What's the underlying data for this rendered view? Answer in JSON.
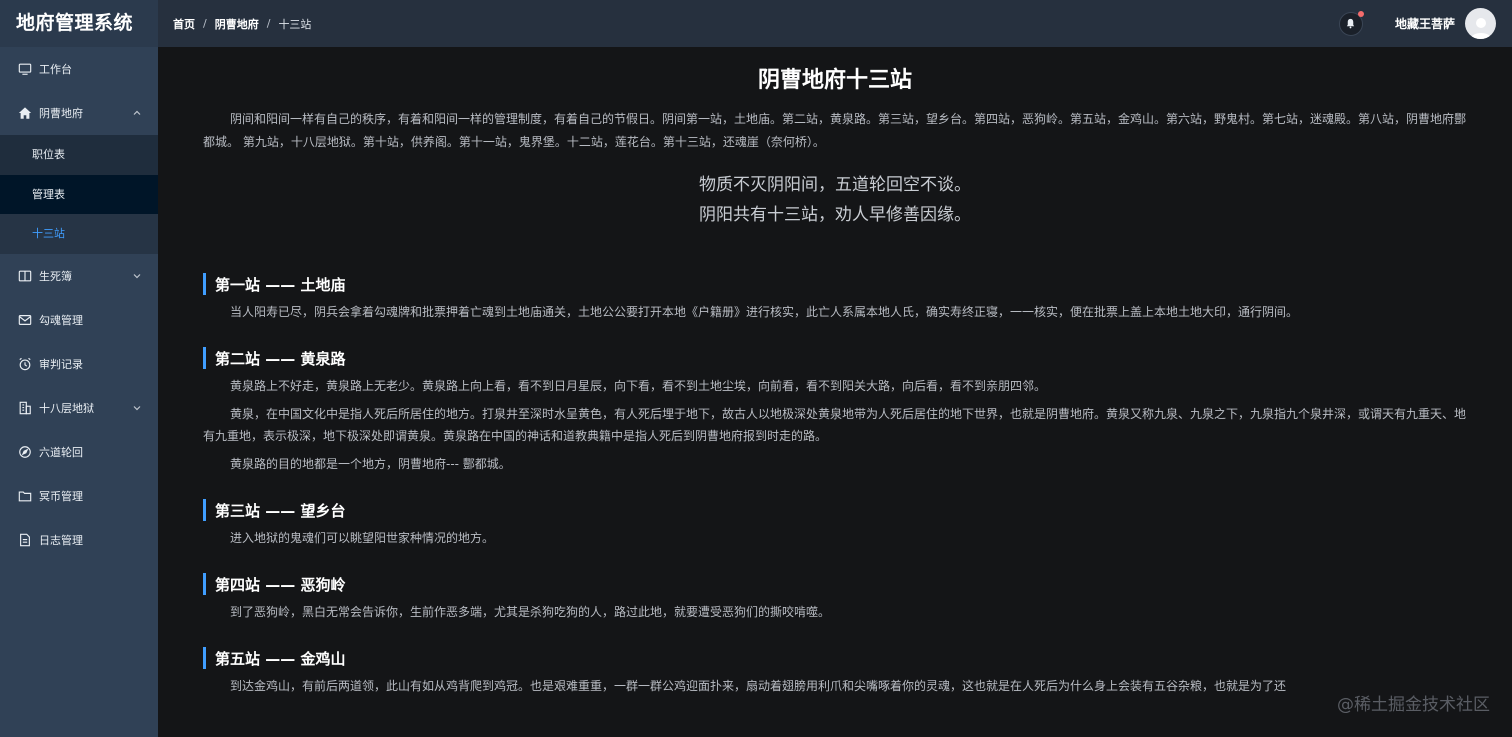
{
  "app": {
    "title": "地府管理系统"
  },
  "sidebar": {
    "items": [
      {
        "label": "工作台",
        "icon": "monitor-icon"
      },
      {
        "label": "阴曹地府",
        "icon": "home-icon",
        "expanded": true,
        "children": [
          {
            "label": "职位表"
          },
          {
            "label": "管理表"
          },
          {
            "label": "十三站",
            "active": true
          }
        ]
      },
      {
        "label": "生死簿",
        "icon": "book-icon"
      },
      {
        "label": "勾魂管理",
        "icon": "mail-icon"
      },
      {
        "label": "审判记录",
        "icon": "alarm-icon"
      },
      {
        "label": "十八层地狱",
        "icon": "building-icon"
      },
      {
        "label": "六道轮回",
        "icon": "compass-icon"
      },
      {
        "label": "冥币管理",
        "icon": "folder-icon"
      },
      {
        "label": "日志管理",
        "icon": "document-icon"
      }
    ]
  },
  "header": {
    "breadcrumb": [
      "首页",
      "阴曹地府",
      "十三站"
    ],
    "username": "地藏王菩萨"
  },
  "content": {
    "title": "阴曹地府十三站",
    "intro": "阴间和阳间一样有自己的秩序，有着和阳间一样的管理制度，有着自己的节假日。阴间第一站，土地庙。第二站，黄泉路。第三站，望乡台。第四站，恶狗岭。第五站，金鸡山。第六站，野鬼村。第七站，迷魂殿。第八站，阴曹地府酆都城。 第九站，十八层地狱。第十站，供养阁。第十一站，鬼界堡。十二站，莲花台。第十三站，还魂崖（奈何桥）。",
    "poem": [
      "物质不灭阴阳间，五道轮回空不谈。",
      "阴阳共有十三站，劝人早修善因缘。"
    ],
    "sections": [
      {
        "title": "第一站 —— 土地庙",
        "paragraphs": [
          "当人阳寿已尽，阴兵会拿着勾魂牌和批票押着亡魂到土地庙通关，土地公公要打开本地《户籍册》进行核实，此亡人系属本地人氏，确实寿终正寝，一一核实，便在批票上盖上本地土地大印，通行阴间。"
        ]
      },
      {
        "title": "第二站 —— 黄泉路",
        "paragraphs": [
          "黄泉路上不好走，黄泉路上无老少。黄泉路上向上看，看不到日月星辰，向下看，看不到土地尘埃，向前看，看不到阳关大路，向后看，看不到亲朋四邻。",
          "黄泉，在中国文化中是指人死后所居住的地方。打泉井至深时水呈黄色，有人死后埋于地下，故古人以地极深处黄泉地带为人死后居住的地下世界，也就是阴曹地府。黄泉又称九泉、九泉之下，九泉指九个泉井深，或谓天有九重天、地有九重地，表示极深，地下极深处即谓黄泉。黄泉路在中国的神话和道教典籍中是指人死后到阴曹地府报到时走的路。",
          "黄泉路的目的地都是一个地方，阴曹地府--- 酆都城。"
        ]
      },
      {
        "title": "第三站 —— 望乡台",
        "paragraphs": [
          "进入地狱的鬼魂们可以眺望阳世家种情况的地方。"
        ]
      },
      {
        "title": "第四站 —— 恶狗岭",
        "paragraphs": [
          "到了恶狗岭，黑白无常会告诉你，生前作恶多端，尤其是杀狗吃狗的人，路过此地，就要遭受恶狗们的撕咬啃噬。"
        ]
      },
      {
        "title": "第五站 —— 金鸡山",
        "paragraphs": [
          "到达金鸡山，有前后两道领，此山有如从鸡背爬到鸡冠。也是艰难重重，一群一群公鸡迎面扑来，扇动着翅膀用利爪和尖嘴啄着你的灵魂，这也就是在人死后为什么身上会装有五谷杂粮，也就是为了还"
        ]
      }
    ]
  },
  "watermark": "@稀土掘金技术社区",
  "colors": {
    "accent": "#409eff",
    "sidebar": "#304156",
    "header": "#26303e",
    "background": "#141517"
  }
}
